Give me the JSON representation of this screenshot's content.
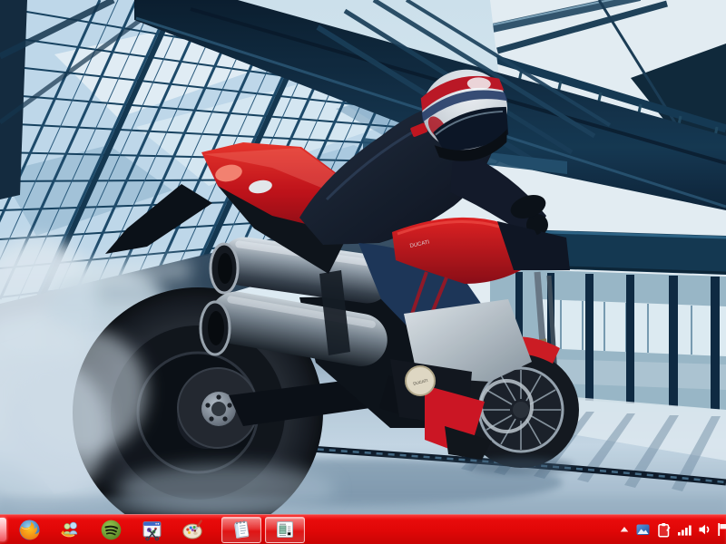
{
  "wallpaper": {
    "subject": "Rider on a red Ducati Streetfighter doing a tire-smoking burnout inside a glass-and-steel industrial hall",
    "bike_badge": "DUCATI",
    "tank_badge": "DUCATI",
    "colors": {
      "bike_red": "#d41420",
      "steel_dark": "#12344c",
      "glass_blue": "#c7dff0",
      "sky_white": "#ecf5f9",
      "floor_blue": "#b7cbda",
      "smoke": "#d9e5ee",
      "taskbar_red": "#e30909"
    }
  },
  "taskbar": {
    "items": [
      {
        "name": "firefox",
        "label": "Firefox"
      },
      {
        "name": "messenger",
        "label": "Windows Live Messenger"
      },
      {
        "name": "spotify",
        "label": "Spotify"
      },
      {
        "name": "snipping-tool",
        "label": "Snipping Tool"
      },
      {
        "name": "paint",
        "label": "Paint"
      },
      {
        "name": "notepad",
        "label": "Notepad",
        "active": true
      },
      {
        "name": "document-viewer",
        "label": "Document Viewer",
        "active": true
      }
    ],
    "tray": [
      {
        "name": "show-hidden-icons",
        "label": "Show hidden icons"
      },
      {
        "name": "tray-application",
        "label": "Tray application"
      },
      {
        "name": "clipboard-tool",
        "label": "Clipboard tool"
      },
      {
        "name": "network",
        "label": "Network"
      },
      {
        "name": "volume",
        "label": "Volume"
      },
      {
        "name": "action-center",
        "label": "Action Center flag"
      }
    ]
  }
}
